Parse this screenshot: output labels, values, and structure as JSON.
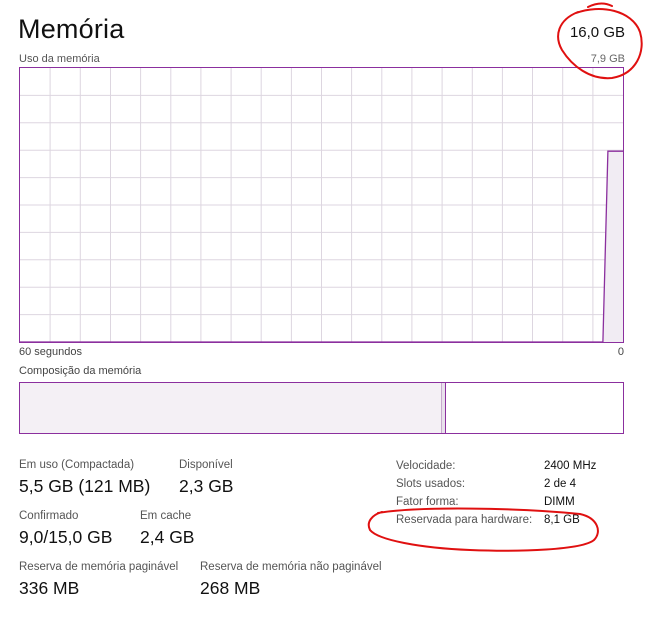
{
  "header": {
    "title": "Memória",
    "total": "16,0 GB"
  },
  "usage_chart": {
    "label": "Uso da memória",
    "max_label": "7,9 GB",
    "time_left": "60 segundos",
    "time_right": "0",
    "line_color": "#8b2f9e",
    "fill_color": "#f1ecf3",
    "grid_color": "#ddd6e0",
    "chart_data": {
      "type": "area",
      "x": [
        60,
        2,
        1.5,
        0
      ],
      "y": [
        0,
        0,
        5.5,
        5.5
      ],
      "ylim": [
        0,
        7.9
      ],
      "xlabel": "",
      "ylabel": "",
      "grid": true
    }
  },
  "composition": {
    "label": "Composição da memória",
    "in_use_fraction": 0.7,
    "modified_fraction": 0.006
  },
  "stats": {
    "in_use_label": "Em uso (Compactada)",
    "in_use_value": "5,5 GB (121 MB)",
    "available_label": "Disponível",
    "available_value": "2,3 GB",
    "committed_label": "Confirmado",
    "committed_value": "9,0/15,0 GB",
    "cached_label": "Em cache",
    "cached_value": "2,4 GB",
    "paged_label": "Reserva de memória paginável",
    "paged_value": "336 MB",
    "nonpaged_label": "Reserva de memória não paginável",
    "nonpaged_value": "268 MB"
  },
  "properties": [
    {
      "key": "Velocidade:",
      "value": "2400 MHz"
    },
    {
      "key": "Slots usados:",
      "value": "2 de 4"
    },
    {
      "key": "Fator forma:",
      "value": "DIMM"
    },
    {
      "key": "Reservada para hardware:",
      "value": "8,1 GB"
    }
  ],
  "annotation_color": "#e01010"
}
